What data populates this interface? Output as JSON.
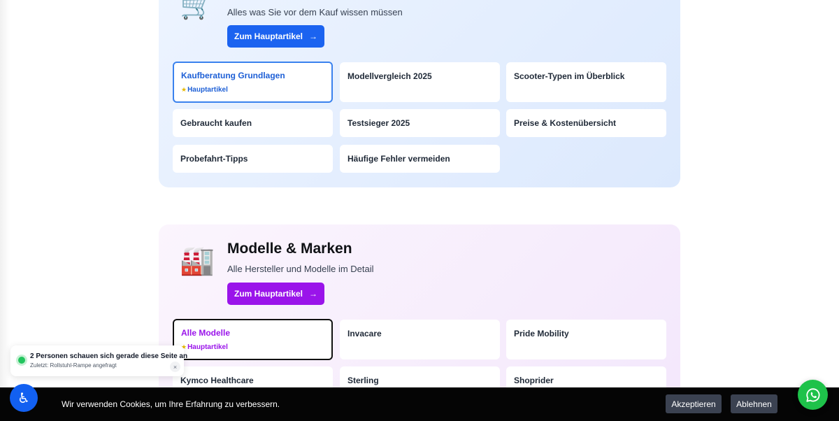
{
  "sections": [
    {
      "icon": "🛒",
      "icon_name": "shopping-cart-icon",
      "subtitle": "Alles was Sie vor dem Kauf wissen müssen",
      "button_label": "Zum Hauptartikel",
      "accent": "#1b63f0",
      "cards": [
        {
          "label": "Kaufberatung Grundlagen",
          "badge": "Hauptartikel"
        },
        {
          "label": "Modellvergleich 2025"
        },
        {
          "label": "Scooter-Typen im Überblick"
        },
        {
          "label": "Gebraucht kaufen"
        },
        {
          "label": "Testsieger 2025"
        },
        {
          "label": "Preise & Kostenübersicht"
        },
        {
          "label": "Probefahrt-Tipps"
        },
        {
          "label": "Häufige Fehler vermeiden"
        }
      ]
    },
    {
      "icon": "🏭",
      "icon_name": "factory-icon",
      "title": "Modelle & Marken",
      "subtitle": "Alle Hersteller und Modelle im Detail",
      "button_label": "Zum Hauptartikel",
      "accent": "#9a14ea",
      "cards": [
        {
          "label": "Alle Modelle",
          "badge": "Hauptartikel"
        },
        {
          "label": "Invacare"
        },
        {
          "label": "Pride Mobility"
        },
        {
          "label": "Kymco Healthcare"
        },
        {
          "label": "Sterling"
        },
        {
          "label": "Shoprider"
        }
      ]
    }
  ],
  "viewers_notice": {
    "text": "2 Personen schauen sich gerade diese Seite an",
    "subtext": "Zuletzt: Rollstuhl-Rampe angefragt",
    "close": "×"
  },
  "cookie_bar": {
    "text": "Wir verwenden Cookies, um Ihre Erfahrung zu verbessern.",
    "accept_label": "Akzeptieren",
    "decline_label": "Ablehnen"
  },
  "icons": {
    "arrow": "→",
    "star": "★",
    "accessibility": "♿",
    "whatsapp": "whatsapp-icon"
  }
}
